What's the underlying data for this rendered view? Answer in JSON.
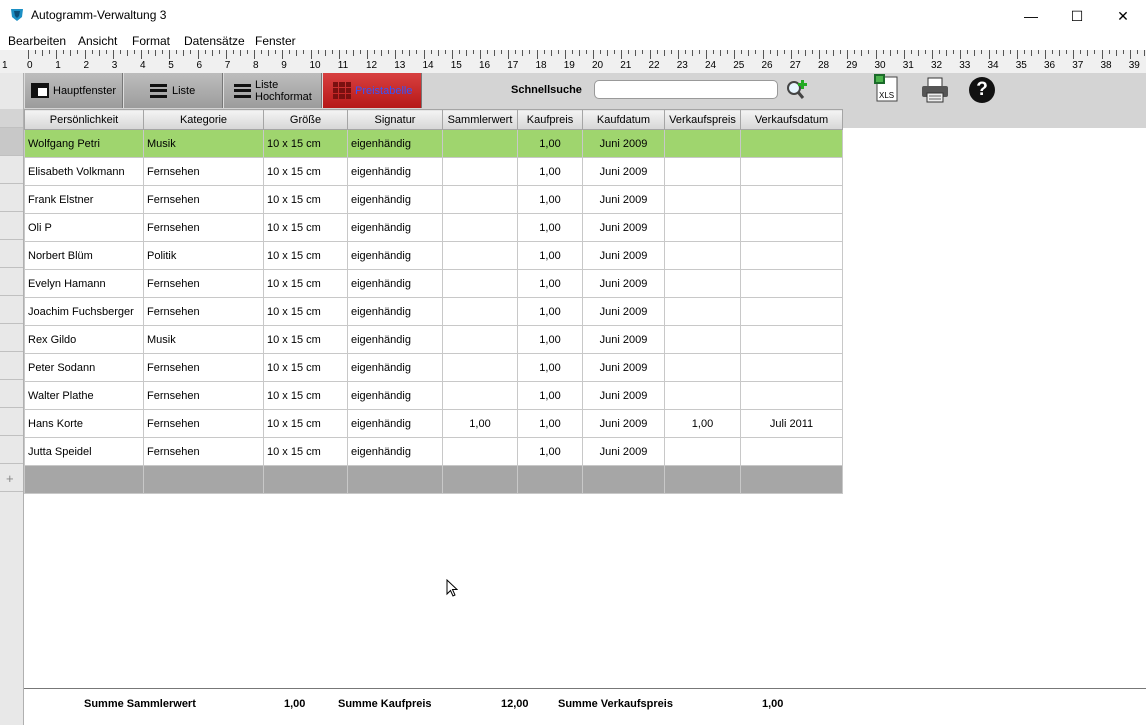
{
  "window": {
    "title": "Autogramm-Verwaltung 3",
    "minimize": "—",
    "maximize": "☐",
    "close": "✕"
  },
  "menu": [
    "Bearbeiten",
    "Ansicht",
    "Format",
    "Datensätze",
    "Fenster"
  ],
  "ruler": {
    "start": "1",
    "marks": [
      "0",
      "1",
      "2",
      "3",
      "4",
      "5",
      "6",
      "7",
      "8",
      "9",
      "10",
      "11",
      "12",
      "13",
      "14",
      "15",
      "16",
      "17",
      "18",
      "19",
      "20",
      "21",
      "22",
      "23",
      "24",
      "25",
      "26",
      "27",
      "28",
      "29",
      "30",
      "31",
      "32",
      "33",
      "34",
      "35",
      "36",
      "37",
      "38",
      "39"
    ]
  },
  "toolbar": {
    "hauptfenster": "Hauptfenster",
    "liste": "Liste",
    "liste_hochformat_1": "Liste",
    "liste_hochformat_2": "Hochformat",
    "preistabelle": "Preistabelle",
    "schnellsuche_label": "Schnellsuche",
    "schnellsuche_value": "",
    "xls_label": "XLS"
  },
  "table": {
    "columns": [
      "Persönlichkeit",
      "Kategorie",
      "Größe",
      "Signatur",
      "Sammlerwert",
      "Kaufpreis",
      "Kaufdatum",
      "Verkaufspreis",
      "Verkaufsdatum"
    ],
    "rows": [
      [
        "Wolfgang Petri",
        "Musik",
        "10 x 15 cm",
        "eigenhändig",
        "",
        "1,00",
        "Juni 2009",
        "",
        ""
      ],
      [
        "Elisabeth Volkmann",
        "Fernsehen",
        "10 x 15 cm",
        "eigenhändig",
        "",
        "1,00",
        "Juni 2009",
        "",
        ""
      ],
      [
        "Frank Elstner",
        "Fernsehen",
        "10 x 15 cm",
        "eigenhändig",
        "",
        "1,00",
        "Juni 2009",
        "",
        ""
      ],
      [
        "Oli P",
        "Fernsehen",
        "10 x 15 cm",
        "eigenhändig",
        "",
        "1,00",
        "Juni 2009",
        "",
        ""
      ],
      [
        "Norbert Blüm",
        "Politik",
        "10 x 15 cm",
        "eigenhändig",
        "",
        "1,00",
        "Juni 2009",
        "",
        ""
      ],
      [
        "Evelyn Hamann",
        "Fernsehen",
        "10 x 15 cm",
        "eigenhändig",
        "",
        "1,00",
        "Juni 2009",
        "",
        ""
      ],
      [
        "Joachim Fuchsberger",
        "Fernsehen",
        "10 x 15 cm",
        "eigenhändig",
        "",
        "1,00",
        "Juni 2009",
        "",
        ""
      ],
      [
        "Rex Gildo",
        "Musik",
        "10 x 15 cm",
        "eigenhändig",
        "",
        "1,00",
        "Juni 2009",
        "",
        ""
      ],
      [
        "Peter Sodann",
        "Fernsehen",
        "10 x 15 cm",
        "eigenhändig",
        "",
        "1,00",
        "Juni 2009",
        "",
        ""
      ],
      [
        "Walter Plathe",
        "Fernsehen",
        "10 x 15 cm",
        "eigenhändig",
        "",
        "1,00",
        "Juni 2009",
        "",
        ""
      ],
      [
        "Hans Korte",
        "Fernsehen",
        "10 x 15 cm",
        "eigenhändig",
        "1,00",
        "1,00",
        "Juni 2009",
        "1,00",
        "Juli 2011"
      ],
      [
        "Jutta Speidel",
        "Fernsehen",
        "10 x 15 cm",
        "eigenhändig",
        "",
        "1,00",
        "Juni 2009",
        "",
        ""
      ]
    ],
    "selected_row": 0,
    "new_row_marker": "+"
  },
  "footer": {
    "sammlerwert_label": "Summe Sammlerwert",
    "sammlerwert_value": "1,00",
    "kaufpreis_label": "Summe Kaufpreis",
    "kaufpreis_value": "12,00",
    "verkaufspreis_label": "Summe Verkaufspreis",
    "verkaufspreis_value": "1,00"
  },
  "colors": {
    "selected_row": "#9fd56e",
    "active_tab": "#c82020",
    "active_tab_text": "#3355ff"
  }
}
